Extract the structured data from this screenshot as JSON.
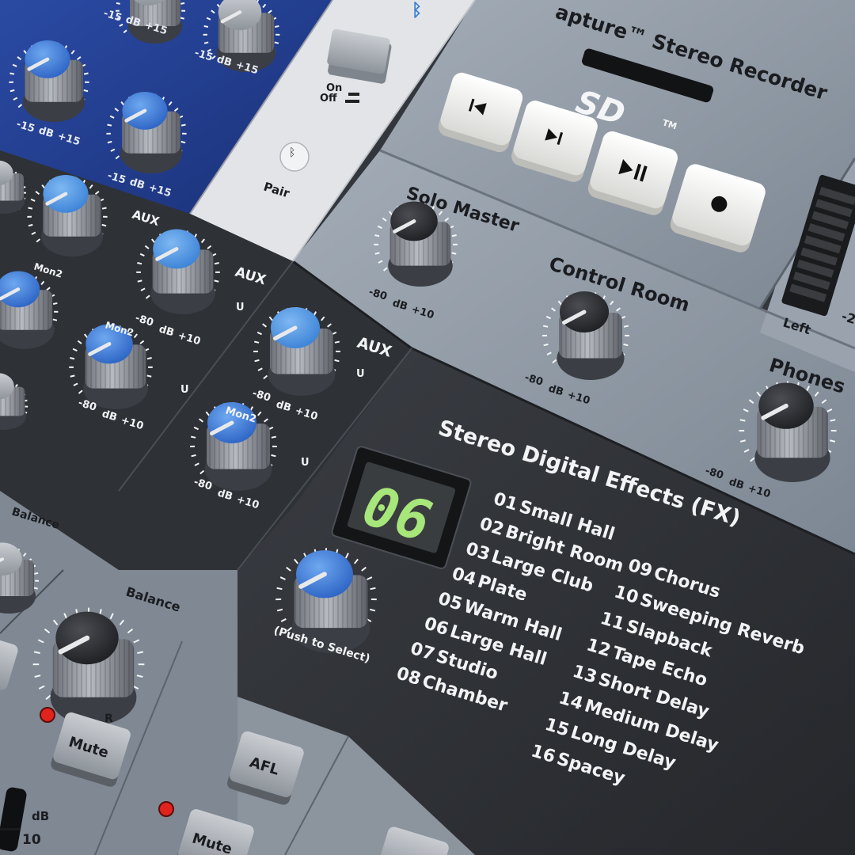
{
  "recorder": {
    "title": "apture™ Stereo Recorder",
    "sd_logo": "SD",
    "tm": "TM",
    "buttons": [
      {
        "name": "previous-button",
        "icon": "previous-track-icon"
      },
      {
        "name": "next-button",
        "icon": "next-track-icon"
      },
      {
        "name": "play-pause-button",
        "icon": "play-pause-icon"
      },
      {
        "name": "record-button",
        "icon": "record-icon"
      }
    ]
  },
  "bluetooth": {
    "on": "On",
    "off": "Off",
    "pair": "Pair",
    "icon": "bluetooth-icon"
  },
  "master": {
    "solo_master": "Solo Master",
    "control_room": "Control Room",
    "phones": "Phones",
    "scale_min": "-80",
    "scale_db": "dB",
    "scale_max": "+10",
    "meter_left": "Left",
    "meter_right": "-2"
  },
  "channel": {
    "aux": "AUX",
    "mon2": "Mon2",
    "u": "U",
    "balance": "Balance",
    "r": "R",
    "mute": "Mute",
    "afl": "AFL",
    "fader_db": "dB",
    "fader_10": "10",
    "eq_min": "-15",
    "eq_db": "dB",
    "eq_max": "+15"
  },
  "fx": {
    "title": "Stereo Digital Effects (FX)",
    "display": "06",
    "push_label": "(Push to Select)",
    "presets_left": [
      {
        "num": "01",
        "name": "Small Hall"
      },
      {
        "num": "02",
        "name": "Bright Room"
      },
      {
        "num": "03",
        "name": "Large Club"
      },
      {
        "num": "04",
        "name": "Plate"
      },
      {
        "num": "05",
        "name": "Warm Hall"
      },
      {
        "num": "06",
        "name": "Large Hall"
      },
      {
        "num": "07",
        "name": "Studio"
      },
      {
        "num": "08",
        "name": "Chamber"
      }
    ],
    "presets_right": [
      {
        "num": "09",
        "name": "Chorus"
      },
      {
        "num": "10",
        "name": "Sweeping Reverb"
      },
      {
        "num": "11",
        "name": "Slapback"
      },
      {
        "num": "12",
        "name": "Tape Echo"
      },
      {
        "num": "13",
        "name": "Short Delay"
      },
      {
        "num": "14",
        "name": "Medium Delay"
      },
      {
        "num": "15",
        "name": "Long Delay"
      },
      {
        "num": "16",
        "name": "Spacey"
      }
    ]
  },
  "colors": {
    "panel_grey": "#8d97a3",
    "panel_dark": "#2f3237",
    "panel_blue": "#243f91",
    "knob_blue": "#3f7fd8",
    "knob_cap_dark": "#2b2c30",
    "led_green": "#a7e67a",
    "led_red": "#e0241d"
  }
}
